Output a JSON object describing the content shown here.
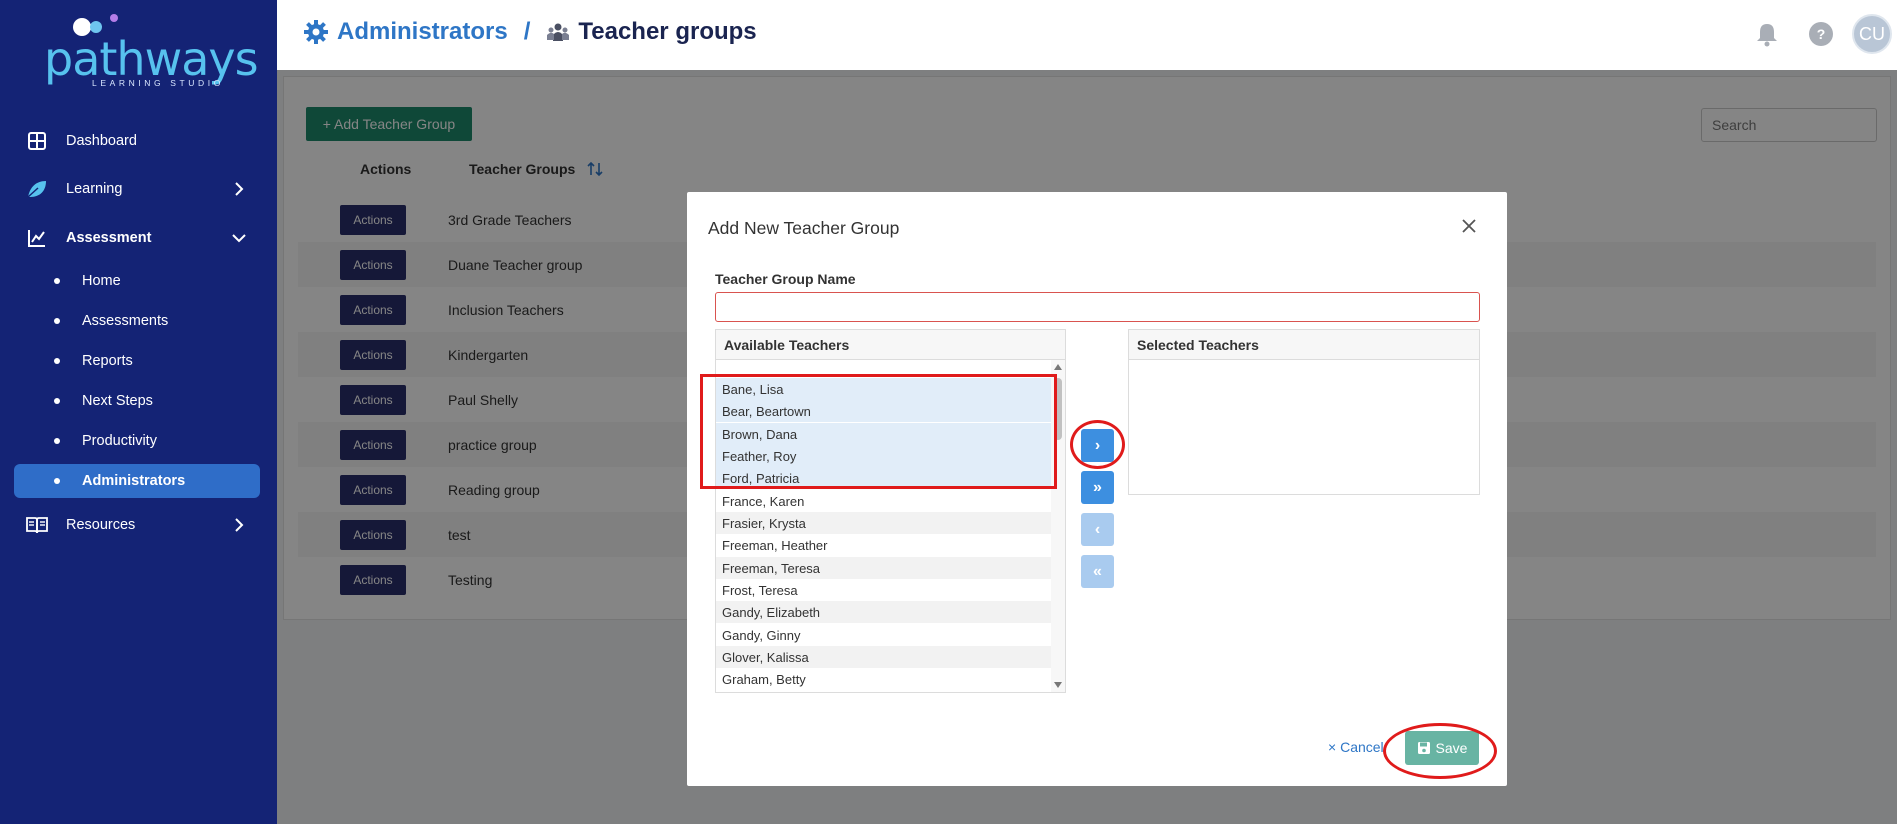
{
  "brand": {
    "name": "pathways",
    "tagline": "LEARNING STUDIO"
  },
  "sidebar": {
    "items": [
      {
        "label": "Dashboard",
        "icon": "dashboard-grid-icon"
      },
      {
        "label": "Learning",
        "icon": "leaf-icon"
      },
      {
        "label": "Assessment",
        "icon": "chart-icon"
      },
      {
        "label": "Resources",
        "icon": "book-icon"
      }
    ],
    "assessment_sub": [
      {
        "label": "Home"
      },
      {
        "label": "Assessments"
      },
      {
        "label": "Reports"
      },
      {
        "label": "Next Steps"
      },
      {
        "label": "Productivity"
      },
      {
        "label": "Administrators",
        "active": true
      }
    ]
  },
  "header": {
    "breadcrumb_root": "Administrators",
    "breadcrumb_sep": "/",
    "breadcrumb_current": "Teacher groups",
    "avatar_initials": "CU"
  },
  "page": {
    "add_button": "+ Add Teacher Group",
    "search_placeholder": "Search",
    "col_actions": "Actions",
    "col_groups": "Teacher Groups",
    "rows": [
      {
        "action": "Actions",
        "name": "3rd Grade Teachers"
      },
      {
        "action": "Actions",
        "name": "Duane Teacher group"
      },
      {
        "action": "Actions",
        "name": "Inclusion Teachers"
      },
      {
        "action": "Actions",
        "name": "Kindergarten"
      },
      {
        "action": "Actions",
        "name": "Paul Shelly"
      },
      {
        "action": "Actions",
        "name": "practice group"
      },
      {
        "action": "Actions",
        "name": "Reading group"
      },
      {
        "action": "Actions",
        "name": "test"
      },
      {
        "action": "Actions",
        "name": "Testing"
      }
    ]
  },
  "modal": {
    "title": "Add New Teacher Group",
    "name_label": "Teacher Group Name",
    "name_value": "",
    "available_label": "Available Teachers",
    "selected_label": "Selected Teachers",
    "available_teachers": [
      {
        "name": "Bane, Lisa",
        "selected": true
      },
      {
        "name": "Bear, Beartown",
        "selected": true
      },
      {
        "name": "Brown, Dana",
        "selected": true
      },
      {
        "name": "Feather, Roy",
        "selected": true
      },
      {
        "name": "Ford, Patricia",
        "selected": true
      },
      {
        "name": "France, Karen",
        "selected": false
      },
      {
        "name": "Frasier, Krysta",
        "selected": false
      },
      {
        "name": "Freeman, Heather",
        "selected": false
      },
      {
        "name": "Freeman, Teresa",
        "selected": false
      },
      {
        "name": "Frost, Teresa",
        "selected": false
      },
      {
        "name": "Gandy, Elizabeth",
        "selected": false
      },
      {
        "name": "Gandy, Ginny",
        "selected": false
      },
      {
        "name": "Glover, Kalissa",
        "selected": false
      },
      {
        "name": "Graham, Betty",
        "selected": false
      }
    ],
    "selected_teachers": [],
    "move_right": "›",
    "move_all_right": "»",
    "move_left": "‹",
    "move_all_left": "«",
    "cancel_label": "Cancel",
    "save_label": "Save"
  },
  "colors": {
    "sidebar_bg": "#142375",
    "accent_blue": "#2e76c6",
    "active_nav": "#2f6dc8",
    "add_green": "#1e8a6c",
    "save_green": "#68b4a3",
    "annotation_red": "#e01b1b"
  }
}
